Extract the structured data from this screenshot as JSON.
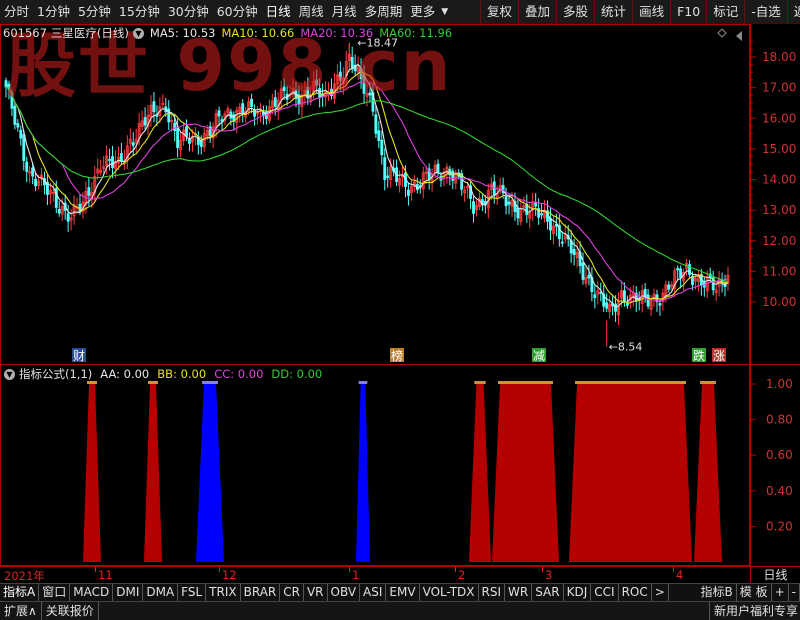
{
  "toolbar": {
    "periods": [
      "分时",
      "1分钟",
      "5分钟",
      "15分钟",
      "30分钟",
      "60分钟",
      "日线",
      "周线",
      "月线",
      "多周期",
      "更多"
    ],
    "active_period": "日线",
    "actions": [
      "复权",
      "叠加",
      "多股",
      "统计",
      "画线",
      "F10",
      "标记",
      "-自选",
      "返回"
    ]
  },
  "watermark": "股世 998.cn",
  "stock": {
    "code": "601567",
    "name": "三星医疗(日线)"
  },
  "ma": [
    {
      "label": "MA5: 10.53",
      "color": "#e8e8e8"
    },
    {
      "label": "MA10: 10.66",
      "color": "#e8e020"
    },
    {
      "label": "MA20: 10.36",
      "color": "#e040e0"
    },
    {
      "label": "MA60: 11.96",
      "color": "#30d030"
    }
  ],
  "price_axis": [
    "18.00",
    "17.00",
    "16.00",
    "15.00",
    "14.00",
    "13.00",
    "12.00",
    "11.00",
    "10.00"
  ],
  "annotations": {
    "high": "18.47",
    "low": "8.54"
  },
  "markers": [
    {
      "text": "财",
      "bg": "#2a4a9a",
      "color": "#ffffff"
    },
    {
      "text": "榜",
      "bg": "#c08030",
      "color": "#ffffff"
    },
    {
      "text": "减",
      "bg": "#30a030",
      "color": "#ffffff"
    },
    {
      "text": "跌",
      "bg": "#30a030",
      "color": "#ffffff"
    },
    {
      "text": "涨",
      "bg": "#c03030",
      "color": "#ffffff"
    }
  ],
  "indicator": {
    "name": "指标公式(1,1)",
    "values": [
      {
        "label": "AA: 0.00",
        "color": "#e8e8e8"
      },
      {
        "label": "BB: 0.00",
        "color": "#e8e020"
      },
      {
        "label": "CC: 0.00",
        "color": "#e040e0"
      },
      {
        "label": "DD: 0.00",
        "color": "#30d030"
      }
    ],
    "axis": [
      "1.00",
      "0.80",
      "0.60",
      "0.40",
      "0.20"
    ]
  },
  "time_axis": [
    "2021年",
    "11",
    "12",
    "1",
    "2",
    "3",
    "4"
  ],
  "period_button": "日线",
  "indicator_tabs": [
    "指标A",
    "窗口",
    "MACD",
    "DMI",
    "DMA",
    "FSL",
    "TRIX",
    "BRAR",
    "CR",
    "VR",
    "OBV",
    "ASI",
    "EMV",
    "VOL-TDX",
    "RSI",
    "WR",
    "SAR",
    "KDJ",
    "CCI",
    "ROC",
    ">",
    "指标B",
    "模 板",
    "+",
    "-"
  ],
  "bottom": {
    "expand": "扩展∧",
    "related": "关联报价",
    "promo": "新用户福利专享"
  },
  "colors": {
    "up": "#ff3c3c",
    "down": "#54ffff",
    "signal_red": "#b40000",
    "signal_blue": "#0000ff"
  }
}
